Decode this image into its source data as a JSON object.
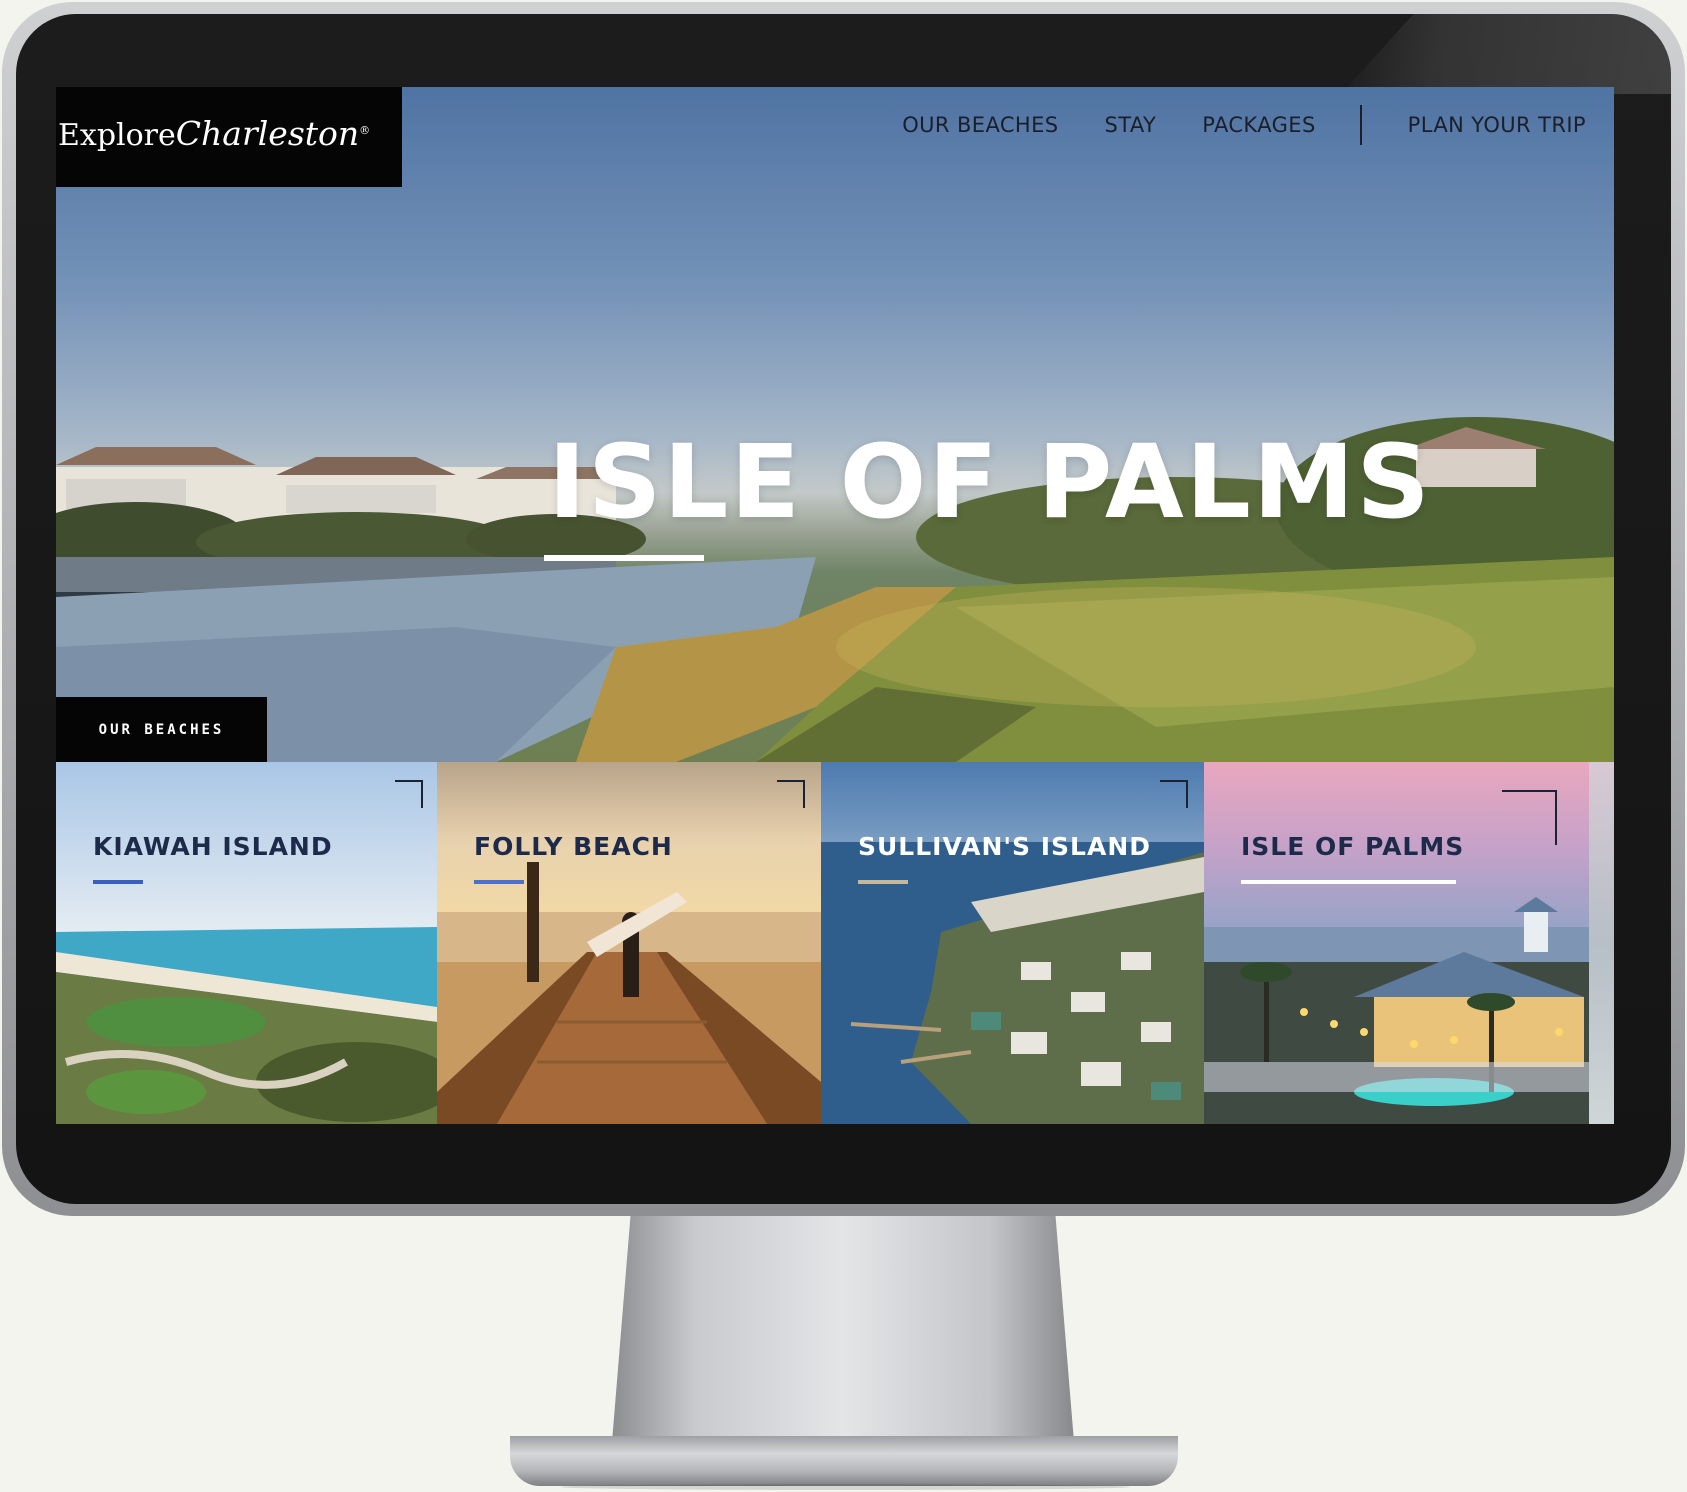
{
  "site": {
    "logo_word1": "Explore",
    "logo_word2": "Charleston",
    "logo_mark": "®"
  },
  "nav": {
    "items": [
      {
        "label": "OUR BEACHES"
      },
      {
        "label": "STAY"
      },
      {
        "label": "PACKAGES"
      }
    ],
    "cta": "PLAN YOUR TRIP"
  },
  "hero": {
    "title": "ISLE OF PALMS",
    "section_tag": "OUR BEACHES"
  },
  "cards": [
    {
      "title": "KIAWAH ISLAND",
      "title_color": "#1e2a4a",
      "line_color": "#3a5fbf"
    },
    {
      "title": "FOLLY BEACH",
      "title_color": "#1e2a4a",
      "line_color": "#4c6fd0"
    },
    {
      "title": "SULLIVAN'S ISLAND",
      "title_color": "#ffffff",
      "line_color": "#c7b79a"
    },
    {
      "title": "ISLE OF PALMS",
      "title_color": "#1e2a4a",
      "line_color": "#ffffff"
    }
  ],
  "colors": {
    "logo_bg": "#050505",
    "nav_text": "#1b1f2a",
    "accent_blue": "#3a5fbf"
  }
}
